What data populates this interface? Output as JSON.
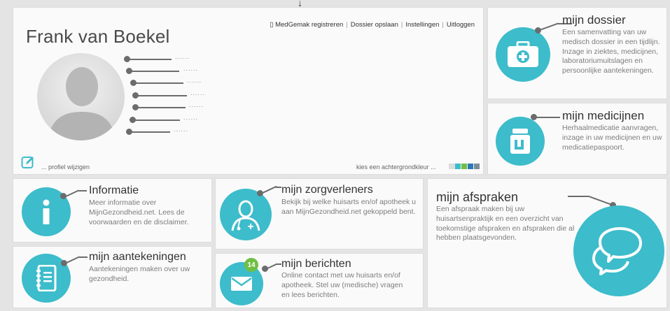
{
  "top_arrow": "↓",
  "profile": {
    "name": "Frank van Boekel",
    "nav": [
      "MedGemak registreren",
      "Dossier opslaan",
      "Instellingen",
      "Uitloggen"
    ],
    "field_placeholder": "......",
    "edit_label": "... profiel wijzigen",
    "background_label": "kies een achtergrondkleur ...",
    "swatches": [
      "#dcdcdc",
      "#3dbccb",
      "#6fbf44",
      "#2b79b5",
      "#7d8b99"
    ]
  },
  "dossier": {
    "title": "mijn dossier",
    "desc": "Een samenvatting van uw medisch dossier in een tijdlijn. Inzage in ziektes, medicijnen, laboratoriumuitslagen en persoonlijke aantekeningen."
  },
  "medicijnen": {
    "title": "mijn medicijnen",
    "desc": "Herhaalmedicatie aanvragen, inzage in uw medicijnen en uw medicatiepaspoort."
  },
  "informatie": {
    "title": "Informatie",
    "desc": "Meer informatie over MijnGezondheid.net. Lees de voorwaarden en de disclaimer."
  },
  "zorgverleners": {
    "title": "mijn zorgverleners",
    "desc": "Bekijk bij welke huisarts en/of apotheek u aan MijnGezondheid.net gekoppeld bent."
  },
  "afspraken": {
    "title": "mijn afspraken",
    "desc": "Een afspraak maken bij uw huisartsenpraktijk en een overzicht van toekomstige afspraken en afspraken die al hebben plaatsgevonden."
  },
  "aantekeningen": {
    "title": "mijn aantekeningen",
    "desc": "Aantekeningen maken over uw gezondheid."
  },
  "berichten": {
    "title": "mijn berichten",
    "badge": "14",
    "desc": "Online contact met uw huisarts en/of apotheek. Stel uw (medische) vragen en lees berichten."
  },
  "icons": {
    "dossier": "medical-case-icon",
    "medicijnen": "medicine-jar-icon",
    "informatie": "info-icon",
    "zorgverleners": "doctor-icon",
    "afspraken": "chat-bubbles-icon",
    "aantekeningen": "notebook-icon",
    "berichten": "envelope-icon",
    "edit": "pencil-icon"
  },
  "accent_color": "#3dbccb"
}
